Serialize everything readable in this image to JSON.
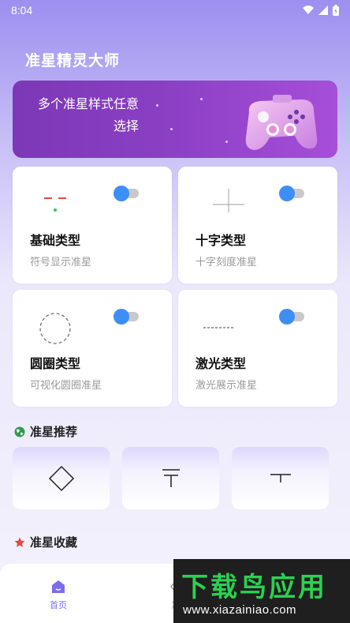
{
  "status_bar": {
    "time": "8:04"
  },
  "app": {
    "title": "准星精灵大师"
  },
  "banner": {
    "text": "多个准星样式任意选择",
    "accent": "#8a3fc3"
  },
  "cards": [
    {
      "title": "基础类型",
      "subtitle": "符号显示准星",
      "icon": "basic-crosshair-icon",
      "enabled": true
    },
    {
      "title": "十字类型",
      "subtitle": "十字刻度准星",
      "icon": "cross-crosshair-icon",
      "enabled": true
    },
    {
      "title": "圆圈类型",
      "subtitle": "可视化圆圈准星",
      "icon": "circle-crosshair-icon",
      "enabled": true
    },
    {
      "title": "激光类型",
      "subtitle": "激光展示准星",
      "icon": "laser-crosshair-icon",
      "enabled": true
    }
  ],
  "sections": {
    "recommend": "准星推荐",
    "favorites": "准星收藏"
  },
  "recommend_tiles": [
    "diamond-crosshair-icon",
    "t-crosshair-icon",
    "short-t-crosshair-icon"
  ],
  "bottom_nav": {
    "home": "首页",
    "second_partial": "准"
  },
  "watermark": {
    "main": "下载鸟应用",
    "sub": "www.xiazainiao.com"
  },
  "colors": {
    "toggle_on": "#3e8ef7",
    "nav_active": "#7b6cf0",
    "watermark_green": "#2bd14f"
  }
}
